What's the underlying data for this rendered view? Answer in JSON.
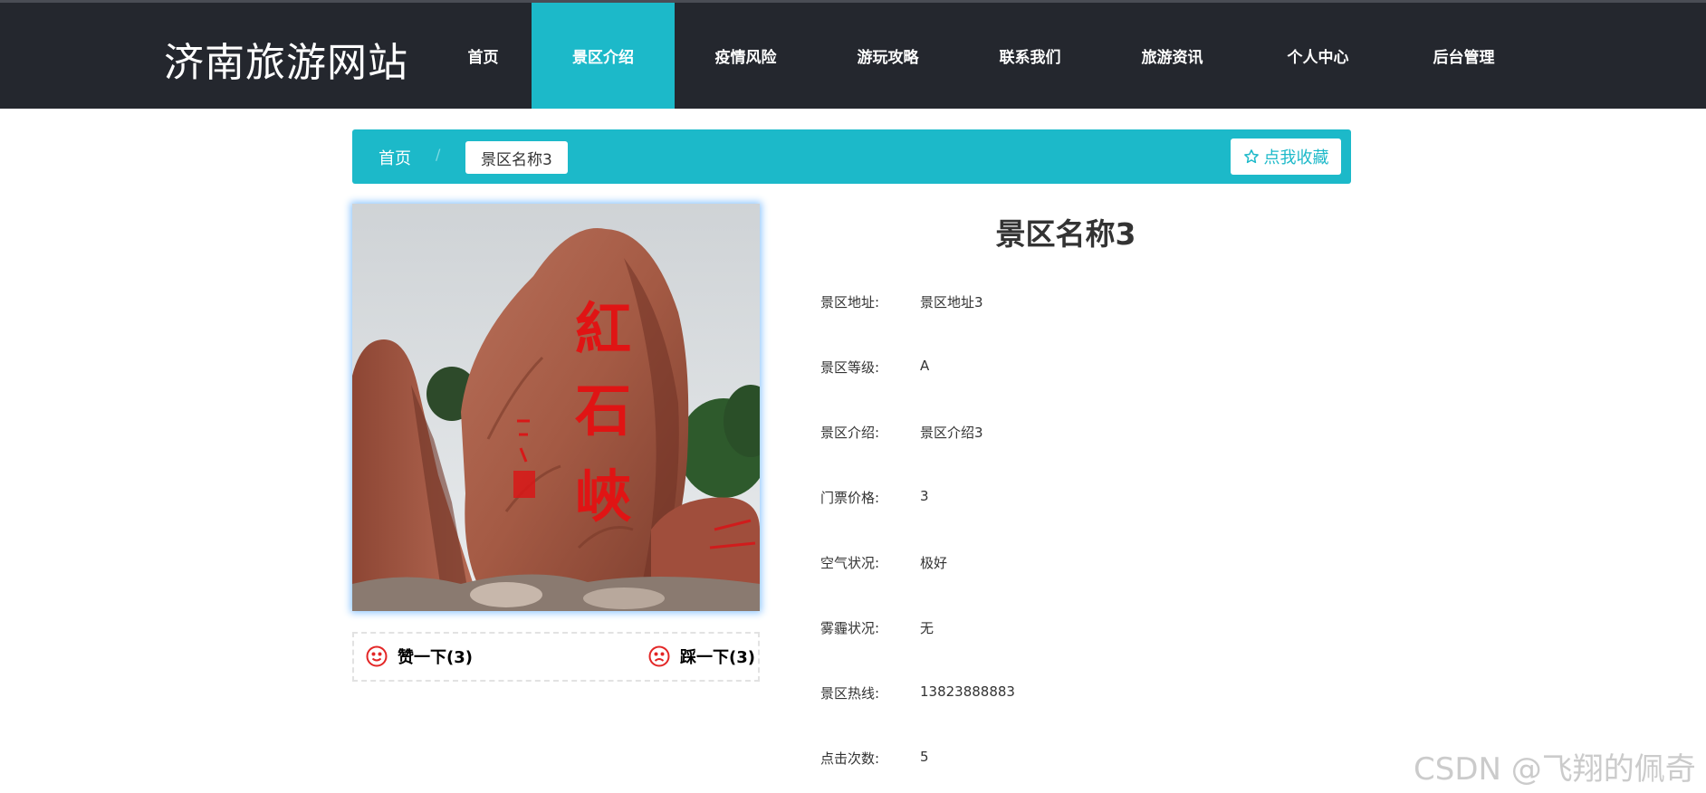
{
  "header": {
    "site_title": "济南旅游网站",
    "nav": [
      {
        "label": "首页",
        "active": false
      },
      {
        "label": "景区介绍",
        "active": true
      },
      {
        "label": "疫情风险",
        "active": false
      },
      {
        "label": "游玩攻略",
        "active": false
      },
      {
        "label": "联系我们",
        "active": false
      },
      {
        "label": "旅游资讯",
        "active": false
      },
      {
        "label": "个人中心",
        "active": false
      },
      {
        "label": "后台管理",
        "active": false
      }
    ]
  },
  "breadcrumb": {
    "home": "首页",
    "separator": "/",
    "current": "景区名称3",
    "favorite_label": "点我收藏"
  },
  "photo": {
    "alt": "红石峡",
    "carved_text": "紅石峽"
  },
  "votes": {
    "like_label": "赞一下(3)",
    "dislike_label": "踩一下(3)"
  },
  "detail": {
    "title": "景区名称3",
    "fields": [
      {
        "label": "景区地址:",
        "value": "景区地址3"
      },
      {
        "label": "景区等级:",
        "value": "A"
      },
      {
        "label": "景区介绍:",
        "value": "景区介绍3"
      },
      {
        "label": "门票价格:",
        "value": "3"
      },
      {
        "label": "空气状况:",
        "value": "极好"
      },
      {
        "label": "雾霾状况:",
        "value": "无"
      },
      {
        "label": "景区热线:",
        "value": "13823888883"
      },
      {
        "label": "点击次数:",
        "value": "5"
      }
    ]
  },
  "watermark": "CSDN @飞翔的佩奇",
  "colors": {
    "accent": "#1cb9c9",
    "nav_bg": "#24272e",
    "vote_icon": "#e32626"
  }
}
